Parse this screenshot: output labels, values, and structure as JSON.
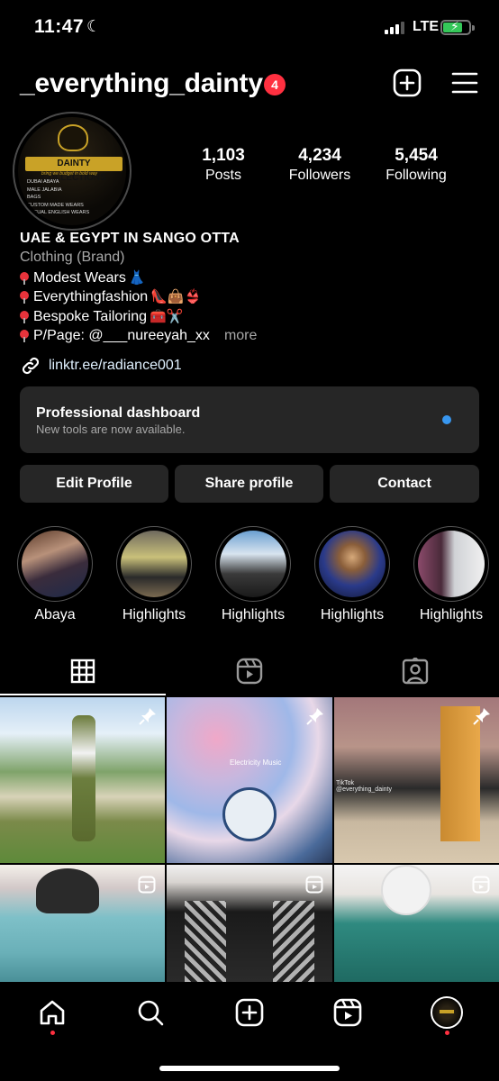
{
  "status_bar": {
    "time": "11:47",
    "network": "LTE"
  },
  "header": {
    "username": "_everything_dainty",
    "notification_count": "4"
  },
  "profile": {
    "avatar_brand": "DAINTY COLLECTIONS",
    "avatar_tagline": "bring we budget in bold way",
    "avatar_lines": [
      "DUBAI ABAYA",
      "MALE JALABIA",
      "BAGS",
      "CUSTOM MADE WEARS",
      "CASUAL ENGLISH WEARS",
      "ABAYA"
    ],
    "stats": [
      {
        "value": "1,103",
        "label": "Posts"
      },
      {
        "value": "4,234",
        "label": "Followers"
      },
      {
        "value": "5,454",
        "label": "Following"
      }
    ],
    "name": "UAE & EGYPT IN SANGO OTTA",
    "category": "Clothing (Brand)",
    "bio_lines": [
      {
        "text": "Modest Wears",
        "emoji": "👗"
      },
      {
        "text": "Everythingfashion",
        "emoji": "👠👜👙"
      },
      {
        "text": "Bespoke Tailoring",
        "emoji": "🧰✂️"
      },
      {
        "text": "P/Page:  @___nureeyah_xx",
        "emoji": ""
      }
    ],
    "more_label": "more",
    "link": "linktr.ee/radiance001"
  },
  "dashboard": {
    "title": "Professional dashboard",
    "subtitle": "New tools are now available."
  },
  "buttons": {
    "edit": "Edit Profile",
    "share": "Share profile",
    "contact": "Contact"
  },
  "highlights": [
    {
      "label": "Abaya"
    },
    {
      "label": "Highlights"
    },
    {
      "label": "Highlights"
    },
    {
      "label": "Highlights"
    },
    {
      "label": "Highlights"
    }
  ],
  "grid_overlays": {
    "music_text": "Electricity Music",
    "tiktok_mark": "TikTok",
    "tiktok_user": "@everything_dainty"
  },
  "colors": {
    "background": "#000000",
    "surface": "#262626",
    "badge_red": "#ff3040",
    "accent_blue": "#3897f0",
    "brand_gold": "#c9a227"
  }
}
